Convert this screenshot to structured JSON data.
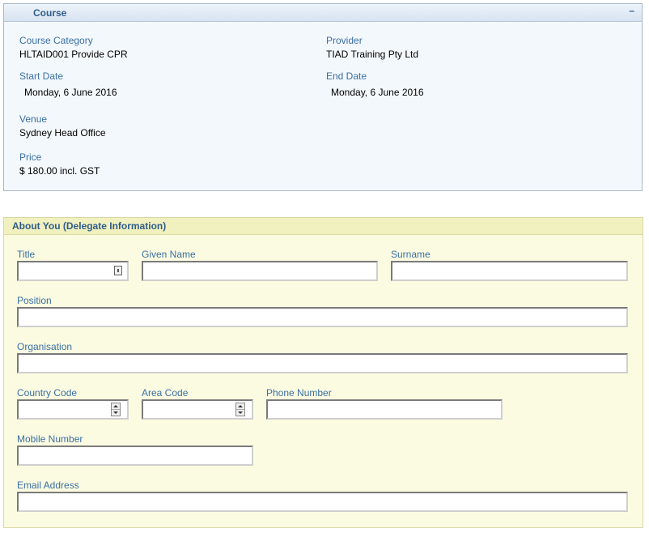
{
  "colors": {
    "label": "#3a6fa3",
    "course_panel_bg": "#f3f8fc",
    "about_panel_bg": "#fbfbe2",
    "about_header_bg": "#f1f0bf"
  },
  "course": {
    "title": "Course",
    "collapse_symbol": "–",
    "category_label": "Course Category",
    "category_value": "HLTAID001 Provide CPR",
    "provider_label": "Provider",
    "provider_value": "TIAD Training Pty Ltd",
    "start_label": "Start Date",
    "start_value": "Monday, 6 June 2016",
    "end_label": "End Date",
    "end_value": "Monday, 6 June 2016",
    "venue_label": "Venue",
    "venue_value": "Sydney Head Office",
    "price_label": "Price",
    "price_value": "$ 180.00 incl. GST"
  },
  "about": {
    "title": "About You (Delegate Information)",
    "title_label": "Title",
    "title_value": "",
    "title_picker_icon": "list-picker-icon",
    "given_name_label": "Given Name",
    "given_name_value": "",
    "surname_label": "Surname",
    "surname_value": "",
    "position_label": "Position",
    "position_value": "",
    "organisation_label": "Organisation",
    "organisation_value": "",
    "country_code_label": "Country Code",
    "country_code_value": "",
    "area_code_label": "Area Code",
    "area_code_value": "",
    "phone_label": "Phone Number",
    "phone_value": "",
    "mobile_label": "Mobile Number",
    "mobile_value": "",
    "email_label": "Email Address",
    "email_value": ""
  }
}
